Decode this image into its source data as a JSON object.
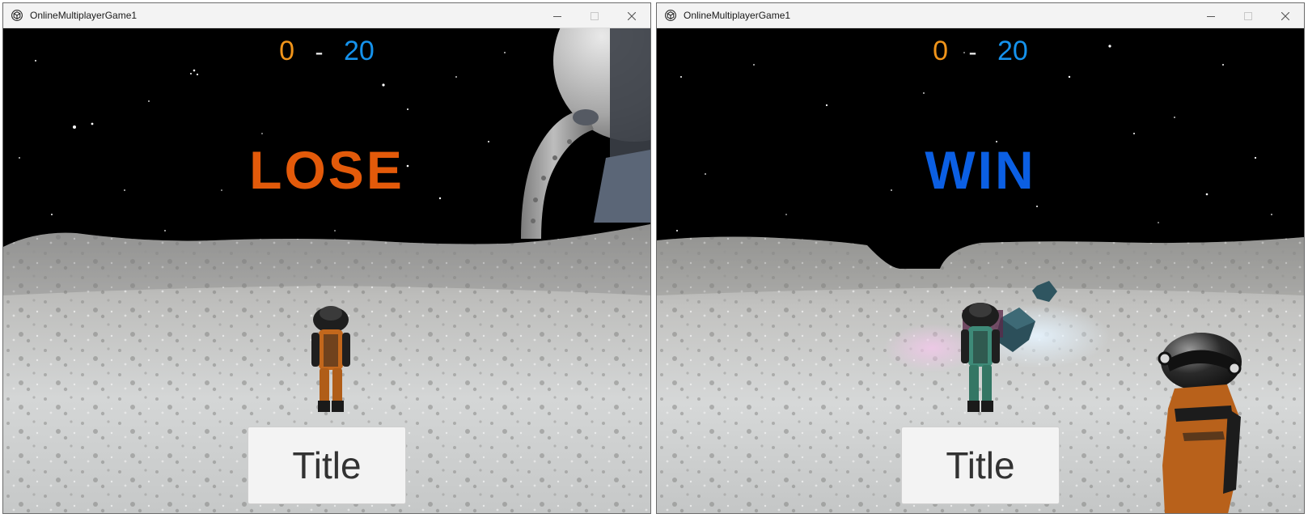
{
  "windows": [
    {
      "app_title": "OnlineMultiplayerGame1",
      "app_icon": "unity-icon",
      "controls": [
        "minimize-icon",
        "maximize-icon",
        "close-icon"
      ],
      "score": {
        "orange": "0",
        "separator": "-",
        "blue": "20"
      },
      "result": "LOSE",
      "result_color": "#e35a0a",
      "button": "Title"
    },
    {
      "app_title": "OnlineMultiplayerGame1",
      "app_icon": "unity-icon",
      "controls": [
        "minimize-icon",
        "maximize-icon",
        "close-icon"
      ],
      "score": {
        "orange": "0",
        "separator": "-",
        "blue": "20"
      },
      "result": "WIN",
      "result_color": "#0b5fe3",
      "button": "Title"
    }
  ],
  "colors": {
    "orange_team": "#f0941a",
    "blue_team": "#1592ec",
    "titlebar": "#f3f3f3",
    "button_bg": "#f3f3f3",
    "button_text": "#323232"
  }
}
